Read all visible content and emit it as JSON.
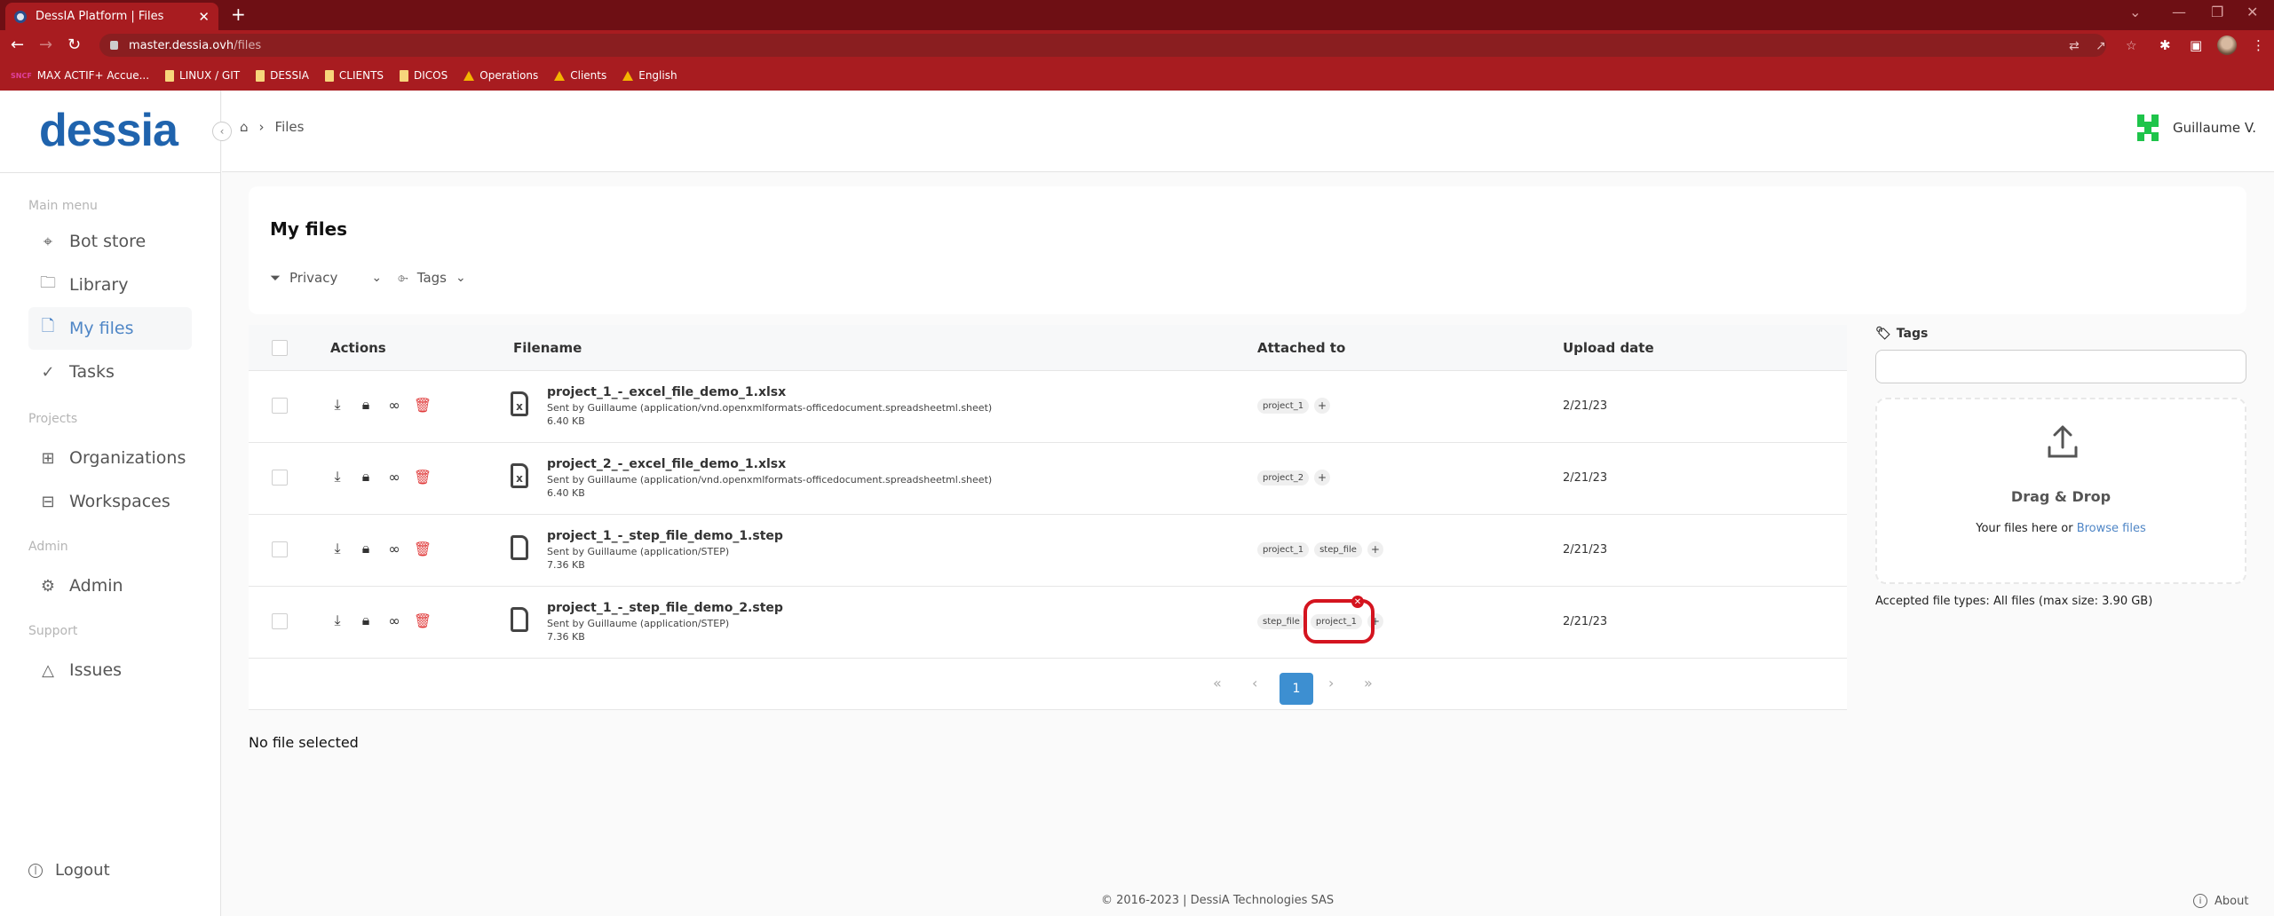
{
  "browser": {
    "tab_title": "DessIA Platform | Files",
    "url_host": "master.dessia.ovh",
    "url_path": "/files",
    "bookmarks": [
      {
        "label": "MAX ACTIF+ Accue...",
        "icon": "sncf-icon"
      },
      {
        "label": "LINUX / GIT",
        "icon": "folder-icon"
      },
      {
        "label": "DESSIA",
        "icon": "folder-icon"
      },
      {
        "label": "CLIENTS",
        "icon": "folder-icon"
      },
      {
        "label": "DICOS",
        "icon": "folder-icon"
      },
      {
        "label": "Operations",
        "icon": "drive-icon"
      },
      {
        "label": "Clients",
        "icon": "drive-icon"
      },
      {
        "label": "English",
        "icon": "drive-icon"
      }
    ]
  },
  "app": {
    "logo": "dessia",
    "breadcrumb": {
      "current": "Files"
    },
    "user_name": "Guillaume V."
  },
  "sidebar": {
    "sections": {
      "main": "Main menu",
      "projects": "Projects",
      "admin": "Admin",
      "support": "Support"
    },
    "items": [
      {
        "label": "Bot store",
        "icon": "bot-store-icon"
      },
      {
        "label": "Library",
        "icon": "folder-icon"
      },
      {
        "label": "My files",
        "icon": "file-icon",
        "active": true
      },
      {
        "label": "Tasks",
        "icon": "check-circle-icon"
      },
      {
        "label": "Organizations",
        "icon": "org-chart-icon"
      },
      {
        "label": "Workspaces",
        "icon": "briefcase-icon"
      },
      {
        "label": "Admin",
        "icon": "user-gear-icon"
      },
      {
        "label": "Issues",
        "icon": "warning-icon"
      }
    ],
    "logout": "Logout"
  },
  "main": {
    "title": "My files",
    "filters": {
      "privacy": "Privacy",
      "tags": "Tags"
    },
    "table": {
      "headers": {
        "actions": "Actions",
        "filename": "Filename",
        "attached_to": "Attached to",
        "upload_date": "Upload date"
      },
      "rows": [
        {
          "filename": "project_1_-_excel_file_demo_1.xlsx",
          "desc": "Sent by Guillaume (application/vnd.openxmlformats-officedocument.spreadsheetml.sheet)",
          "size": "6.40 KB",
          "type": "excel",
          "tags": [
            "project_1"
          ],
          "date": "2/21/23"
        },
        {
          "filename": "project_2_-_excel_file_demo_1.xlsx",
          "desc": "Sent by Guillaume (application/vnd.openxmlformats-officedocument.spreadsheetml.sheet)",
          "size": "6.40 KB",
          "type": "excel",
          "tags": [
            "project_2"
          ],
          "date": "2/21/23"
        },
        {
          "filename": "project_1_-_step_file_demo_1.step",
          "desc": "Sent by Guillaume (application/STEP)",
          "size": "7.36 KB",
          "type": "file",
          "tags": [
            "project_1",
            "step_file"
          ],
          "date": "2/21/23"
        },
        {
          "filename": "project_1_-_step_file_demo_2.step",
          "desc": "Sent by Guillaume (application/STEP)",
          "size": "7.36 KB",
          "type": "file",
          "tags": [
            "step_file",
            "project_1"
          ],
          "date": "2/21/23"
        }
      ]
    },
    "pagination": {
      "first": "«",
      "prev": "‹",
      "current": "1",
      "next": "›",
      "last": "»"
    },
    "no_file": "No file selected"
  },
  "upload": {
    "tags_label": "Tags",
    "tags_value": "",
    "dz_title": "Drag & Drop",
    "dz_text": "Your files here or ",
    "browse": "Browse files",
    "accepted": "Accepted file types: All files (max size: 3.90 GB)"
  },
  "footer": {
    "copyright": "© 2016-2023 | DessiA Technologies SAS",
    "about": "About"
  },
  "colors": {
    "brand": "#1f63ad",
    "accent": "#3d8fd1",
    "chrome": "#a81c20",
    "delete": "#e03b3b",
    "highlight": "#d4141f"
  }
}
